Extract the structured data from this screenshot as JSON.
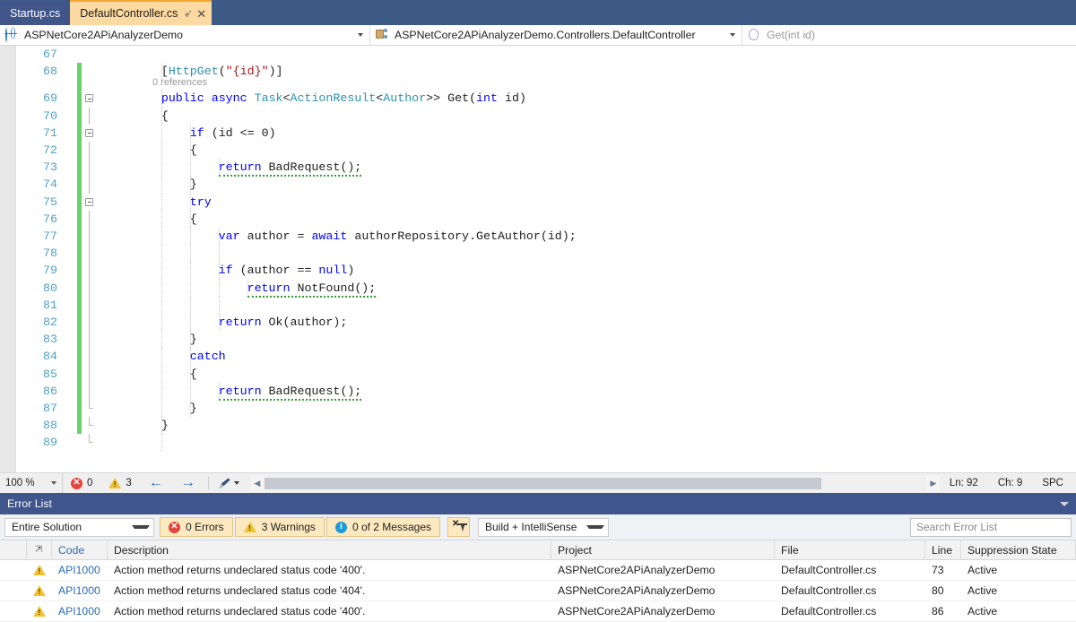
{
  "tabs": [
    {
      "label": "Startup.cs",
      "active": false
    },
    {
      "label": "DefaultController.cs",
      "active": true,
      "pin_icon": "pin-icon",
      "close_icon": "close-icon"
    }
  ],
  "navbar": {
    "project": "ASPNetCore2APiAnalyzerDemo",
    "project_icon": "web-project-icon",
    "class": "ASPNetCore2APiAnalyzerDemo.Controllers.DefaultController",
    "class_icon": "class-icon",
    "member": "Get(int id)",
    "member_icon": "method-icon"
  },
  "editor": {
    "references_label": "0 references",
    "lines": [
      {
        "num": "67",
        "text": ""
      },
      {
        "num": "68",
        "text": "        [HttpGet(\"{id}\")]"
      },
      {
        "num": "69",
        "text": "        public async Task<ActionResult<Author>> Get(int id)"
      },
      {
        "num": "70",
        "text": "        {"
      },
      {
        "num": "71",
        "text": "            if (id <= 0)"
      },
      {
        "num": "72",
        "text": "            {"
      },
      {
        "num": "73",
        "text": "                return BadRequest();"
      },
      {
        "num": "74",
        "text": "            }"
      },
      {
        "num": "75",
        "text": "            try"
      },
      {
        "num": "76",
        "text": "            {"
      },
      {
        "num": "77",
        "text": "                var author = await authorRepository.GetAuthor(id);"
      },
      {
        "num": "78",
        "text": ""
      },
      {
        "num": "79",
        "text": "                if (author == null)"
      },
      {
        "num": "80",
        "text": "                    return NotFound();"
      },
      {
        "num": "81",
        "text": ""
      },
      {
        "num": "82",
        "text": "                return Ok(author);"
      },
      {
        "num": "83",
        "text": "            }"
      },
      {
        "num": "84",
        "text": "            catch"
      },
      {
        "num": "85",
        "text": "            {"
      },
      {
        "num": "86",
        "text": "                return BadRequest();"
      },
      {
        "num": "87",
        "text": "            }"
      },
      {
        "num": "88",
        "text": "        }"
      },
      {
        "num": "89",
        "text": ""
      }
    ]
  },
  "editor_status": {
    "zoom": "100 %",
    "error_count": "0",
    "warning_count": "3",
    "error_icon": "error-circle-icon",
    "warning_icon": "warning-triangle-icon",
    "back_arrow": "arrow-left-icon",
    "forward_arrow": "arrow-right-icon",
    "brush_icon": "color-picker-icon",
    "line": "Ln: 92",
    "char": "Ch: 9",
    "insert_mode": "SPC"
  },
  "error_list": {
    "title": "Error List",
    "scope_filter": "Entire Solution",
    "errors_button": "0 Errors",
    "warnings_button": "3 Warnings",
    "messages_button": "0 of 2 Messages",
    "xfilter_icon": "clear-filter-icon",
    "build_filter": "Build + IntelliSense",
    "search_placeholder": "Search Error List",
    "columns": [
      "",
      "",
      "Code",
      "Description",
      "Project",
      "File",
      "Line",
      "Suppression State"
    ],
    "rows": [
      {
        "severity_icon": "warning-triangle-icon",
        "code": "API1000",
        "description": "Action method returns undeclared status code '400'.",
        "project": "ASPNetCore2APiAnalyzerDemo",
        "file": "DefaultController.cs",
        "line": "73",
        "suppression": "Active"
      },
      {
        "severity_icon": "warning-triangle-icon",
        "code": "API1000",
        "description": "Action method returns undeclared status code '404'.",
        "project": "ASPNetCore2APiAnalyzerDemo",
        "file": "DefaultController.cs",
        "line": "80",
        "suppression": "Active"
      },
      {
        "severity_icon": "warning-triangle-icon",
        "code": "API1000",
        "description": "Action method returns undeclared status code '400'.",
        "project": "ASPNetCore2APiAnalyzerDemo",
        "file": "DefaultController.cs",
        "line": "86",
        "suppression": "Active"
      }
    ]
  },
  "colors": {
    "tab_active_bg": "#fcd9a0",
    "tabbar_bg": "#3d5a87",
    "panel_title_bg": "#40558c",
    "keyword": "#0000ff",
    "type": "#2b91af",
    "string": "#a31515",
    "linenumber": "#51a0c4",
    "change_bar": "#67d16a",
    "warning": "#f2c230",
    "error": "#e5443c",
    "info": "#1e9ad6",
    "link": "#2b6cb0"
  }
}
